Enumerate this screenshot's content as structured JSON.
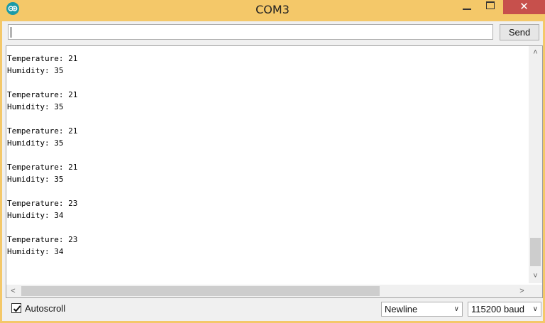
{
  "window": {
    "title": "COM3",
    "close_glyph": "✕"
  },
  "send_bar": {
    "input_value": "",
    "send_label": "Send"
  },
  "output": {
    "entries": [
      {
        "temperature": "Temperature: 21",
        "humidity": "Humidity: 35"
      },
      {
        "temperature": "Temperature: 21",
        "humidity": "Humidity: 35"
      },
      {
        "temperature": "Temperature: 21",
        "humidity": "Humidity: 35"
      },
      {
        "temperature": "Temperature: 21",
        "humidity": "Humidity: 35"
      },
      {
        "temperature": "Temperature: 23",
        "humidity": "Humidity: 34"
      },
      {
        "temperature": "Temperature: 23",
        "humidity": "Humidity: 34"
      }
    ]
  },
  "footer": {
    "autoscroll_label": "Autoscroll",
    "autoscroll_checked": true,
    "line_ending": "Newline",
    "baud_rate": "115200 baud"
  },
  "icons": {
    "app": "arduino-icon",
    "chevron": "chevron-down-icon"
  },
  "colors": {
    "title_bar": "#f4c869",
    "close_button": "#c7504c",
    "app_icon": "#1a9aa7"
  }
}
